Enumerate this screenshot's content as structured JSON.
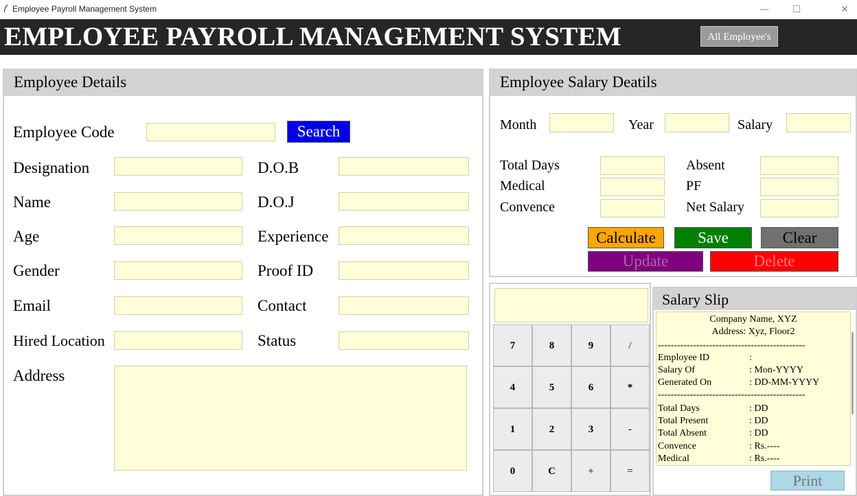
{
  "window": {
    "title": "Employee Payroll Management System",
    "minimize": "—",
    "maximize": "☐",
    "close": "✕"
  },
  "header": {
    "title": "EMPLOYEE PAYROLL MANAGEMENT SYSTEM",
    "all_employees_label": "All Employee's"
  },
  "details": {
    "title": "Employee Details",
    "code_label": "Employee Code",
    "search_label": "Search",
    "designation": "Designation",
    "dob": "D.O.B",
    "name": "Name",
    "doj": "D.O.J",
    "age": "Age",
    "experience": "Experience",
    "gender": "Gender",
    "proof_id": "Proof ID",
    "email": "Email",
    "contact": "Contact",
    "hired_location": "Hired Location",
    "status": "Status",
    "address": "Address"
  },
  "salary": {
    "title": "Employee Salary Deatils",
    "month": "Month",
    "year": "Year",
    "salary": "Salary",
    "total_days": "Total Days",
    "absent": "Absent",
    "medical": "Medical",
    "pf": "PF",
    "convence": "Convence",
    "net_salary": "Net Salary",
    "calculate": "Calculate",
    "save": "Save",
    "clear": "Clear",
    "update": "Update",
    "delete": "Delete"
  },
  "calculator": {
    "keys": [
      [
        "7",
        "8",
        "9",
        "/"
      ],
      [
        "4",
        "5",
        "6",
        "*"
      ],
      [
        "1",
        "2",
        "3",
        "-"
      ],
      [
        "0",
        "C",
        "+",
        "="
      ]
    ]
  },
  "slip": {
    "title": "Salary Slip",
    "company": "Company Name, XYZ",
    "address": "Address: Xyz, Floor2",
    "divider": "----------------------------------------------",
    "rows1": [
      {
        "k": "Employee ID",
        "v": ":"
      },
      {
        "k": "Salary Of",
        "v": ": Mon-YYYY"
      },
      {
        "k": "Generated On",
        "v": ": DD-MM-YYYY"
      }
    ],
    "rows2": [
      {
        "k": "Total Days",
        "v": ": DD"
      },
      {
        "k": "Total Present",
        "v": ": DD"
      },
      {
        "k": "Total Absent",
        "v": ": DD"
      },
      {
        "k": "Convence",
        "v": ": Rs.----"
      },
      {
        "k": "Medical",
        "v": ": Rs.----"
      }
    ],
    "print": "Print"
  },
  "colors": {
    "header_bg": "#262626",
    "input_bg": "#fffed8",
    "search": "#0000e6",
    "calculate": "#ffa500",
    "save": "#008000",
    "clear": "#707070",
    "update": "#800080",
    "delete": "#ff0000",
    "print": "#add8e6"
  }
}
